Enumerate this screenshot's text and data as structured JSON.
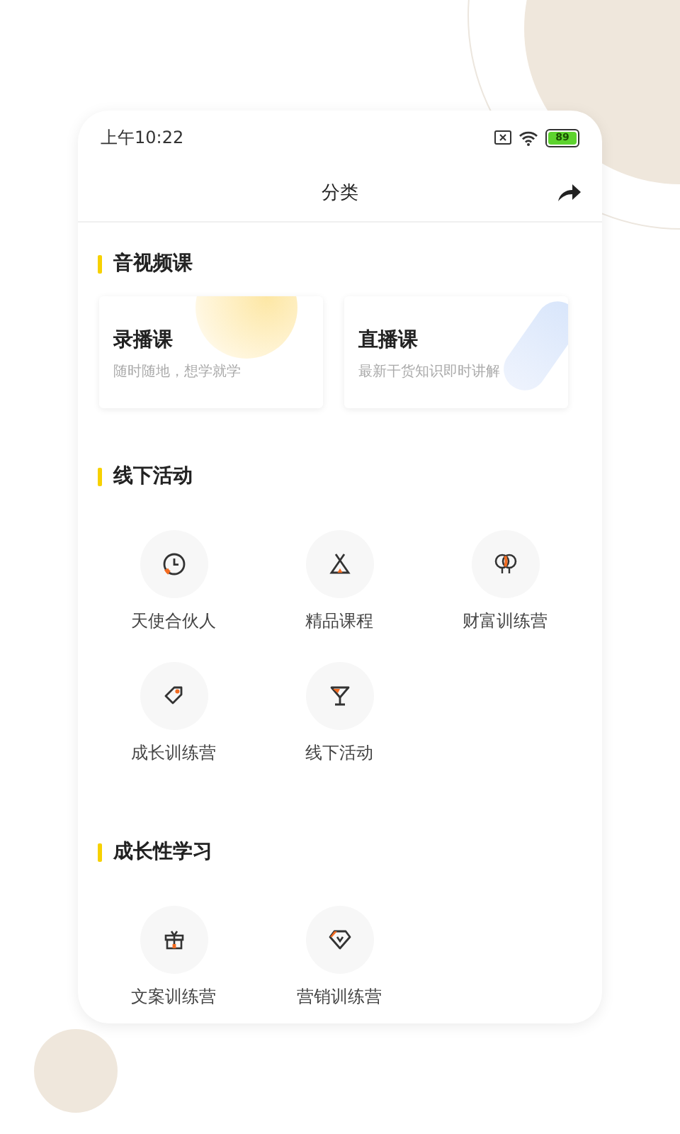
{
  "status_bar": {
    "time": "上午10:22",
    "battery": "89"
  },
  "header": {
    "title": "分类"
  },
  "sections": [
    {
      "title": "音视频课",
      "kind": "cards",
      "cards": [
        {
          "title": "录播课",
          "subtitle": "随时随地，想学就学"
        },
        {
          "title": "直播课",
          "subtitle": "最新干货知识即时讲解"
        }
      ]
    },
    {
      "title": "线下活动",
      "kind": "grid",
      "items": [
        {
          "label": "天使合伙人"
        },
        {
          "label": "精品课程"
        },
        {
          "label": "财富训练营"
        },
        {
          "label": "成长训练营"
        },
        {
          "label": "线下活动"
        }
      ]
    },
    {
      "title": "成长性学习",
      "kind": "grid",
      "items": [
        {
          "label": "文案训练营"
        },
        {
          "label": "营销训练营"
        }
      ]
    }
  ]
}
